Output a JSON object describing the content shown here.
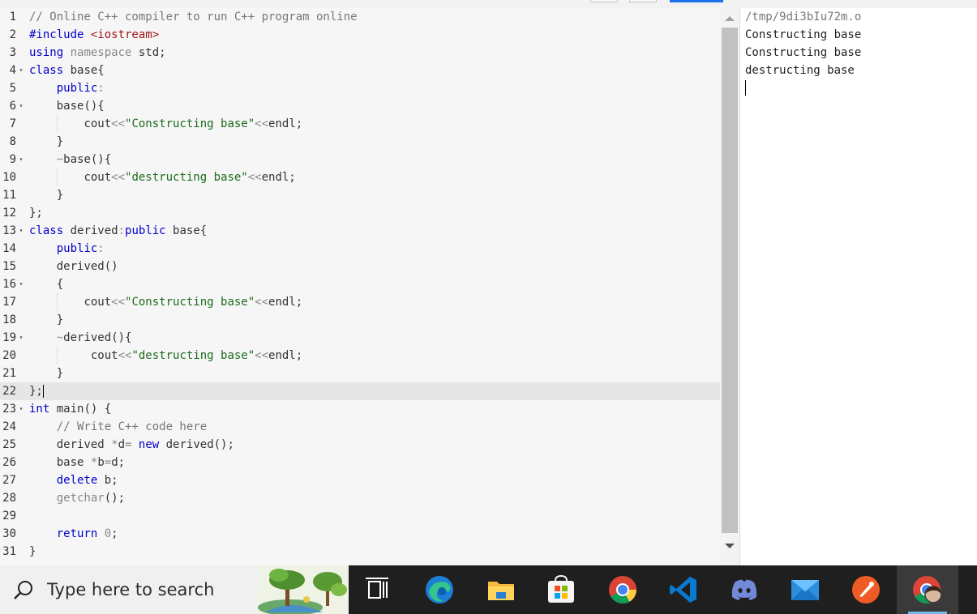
{
  "editor": {
    "lines": [
      {
        "n": "1",
        "fold": "",
        "indent": "",
        "segs": [
          [
            "c",
            "// Online C++ compiler to run C++ program online"
          ]
        ]
      },
      {
        "n": "2",
        "fold": "",
        "indent": "",
        "segs": [
          [
            "k",
            "#include "
          ],
          [
            "p",
            "<iostream>"
          ]
        ]
      },
      {
        "n": "3",
        "fold": "",
        "indent": "",
        "segs": [
          [
            "k",
            "using"
          ],
          [
            "t",
            " "
          ],
          [
            "o",
            "namespace"
          ],
          [
            "t",
            " std;"
          ]
        ]
      },
      {
        "n": "4",
        "fold": "▾",
        "indent": "",
        "segs": [
          [
            "k",
            "class"
          ],
          [
            "t",
            " base{"
          ]
        ]
      },
      {
        "n": "5",
        "fold": "",
        "indent": "    ",
        "segs": [
          [
            "k",
            "public"
          ],
          [
            "o",
            ":"
          ]
        ]
      },
      {
        "n": "6",
        "fold": "▾",
        "indent": "    ",
        "segs": [
          [
            "t",
            "base(){"
          ]
        ]
      },
      {
        "n": "7",
        "fold": "",
        "indent": "        ",
        "segs": [
          [
            "t",
            "cout"
          ],
          [
            "o",
            "<<"
          ],
          [
            "s",
            "\"Constructing base\""
          ],
          [
            "o",
            "<<"
          ],
          [
            "t",
            "endl;"
          ]
        ]
      },
      {
        "n": "8",
        "fold": "",
        "indent": "    ",
        "segs": [
          [
            "t",
            "}"
          ]
        ]
      },
      {
        "n": "9",
        "fold": "▾",
        "indent": "    ",
        "segs": [
          [
            "o",
            "~"
          ],
          [
            "t",
            "base(){"
          ]
        ]
      },
      {
        "n": "10",
        "fold": "",
        "indent": "        ",
        "segs": [
          [
            "t",
            "cout"
          ],
          [
            "o",
            "<<"
          ],
          [
            "s",
            "\"destructing base\""
          ],
          [
            "o",
            "<<"
          ],
          [
            "t",
            "endl;"
          ]
        ]
      },
      {
        "n": "11",
        "fold": "",
        "indent": "    ",
        "segs": [
          [
            "t",
            "}"
          ]
        ]
      },
      {
        "n": "12",
        "fold": "",
        "indent": "",
        "segs": [
          [
            "t",
            "};"
          ]
        ]
      },
      {
        "n": "13",
        "fold": "▾",
        "indent": "",
        "segs": [
          [
            "k",
            "class"
          ],
          [
            "t",
            " derived"
          ],
          [
            "o",
            ":"
          ],
          [
            "k",
            "public"
          ],
          [
            "t",
            " base{"
          ]
        ]
      },
      {
        "n": "14",
        "fold": "",
        "indent": "    ",
        "segs": [
          [
            "k",
            "public"
          ],
          [
            "o",
            ":"
          ]
        ]
      },
      {
        "n": "15",
        "fold": "",
        "indent": "    ",
        "segs": [
          [
            "t",
            "derived()"
          ]
        ]
      },
      {
        "n": "16",
        "fold": "▾",
        "indent": "    ",
        "segs": [
          [
            "t",
            "{"
          ]
        ]
      },
      {
        "n": "17",
        "fold": "",
        "indent": "        ",
        "segs": [
          [
            "t",
            "cout"
          ],
          [
            "o",
            "<<"
          ],
          [
            "s",
            "\"Constructing base\""
          ],
          [
            "o",
            "<<"
          ],
          [
            "t",
            "endl;"
          ]
        ]
      },
      {
        "n": "18",
        "fold": "",
        "indent": "    ",
        "segs": [
          [
            "t",
            "}"
          ]
        ]
      },
      {
        "n": "19",
        "fold": "▾",
        "indent": "    ",
        "segs": [
          [
            "o",
            "~"
          ],
          [
            "t",
            "derived(){"
          ]
        ]
      },
      {
        "n": "20",
        "fold": "",
        "indent": "         ",
        "segs": [
          [
            "t",
            "cout"
          ],
          [
            "o",
            "<<"
          ],
          [
            "s",
            "\"destructing base\""
          ],
          [
            "o",
            "<<"
          ],
          [
            "t",
            "endl;"
          ]
        ]
      },
      {
        "n": "21",
        "fold": "",
        "indent": "    ",
        "segs": [
          [
            "t",
            "}"
          ]
        ]
      },
      {
        "n": "22",
        "fold": "",
        "indent": "",
        "segs": [
          [
            "t",
            "};"
          ]
        ],
        "active": true
      },
      {
        "n": "23",
        "fold": "▾",
        "indent": "",
        "segs": [
          [
            "k",
            "int"
          ],
          [
            "t",
            " main() {"
          ]
        ]
      },
      {
        "n": "24",
        "fold": "",
        "indent": "    ",
        "segs": [
          [
            "c",
            "// Write C++ code here"
          ]
        ]
      },
      {
        "n": "25",
        "fold": "",
        "indent": "    ",
        "segs": [
          [
            "t",
            "derived "
          ],
          [
            "o",
            "*"
          ],
          [
            "t",
            "d"
          ],
          [
            "o",
            "="
          ],
          [
            "t",
            " "
          ],
          [
            "k",
            "new"
          ],
          [
            "t",
            " derived();"
          ]
        ]
      },
      {
        "n": "26",
        "fold": "",
        "indent": "    ",
        "segs": [
          [
            "t",
            "base "
          ],
          [
            "o",
            "*"
          ],
          [
            "t",
            "b"
          ],
          [
            "o",
            "="
          ],
          [
            "t",
            "d;"
          ]
        ]
      },
      {
        "n": "27",
        "fold": "",
        "indent": "    ",
        "segs": [
          [
            "k",
            "delete"
          ],
          [
            "t",
            " b;"
          ]
        ]
      },
      {
        "n": "28",
        "fold": "",
        "indent": "    ",
        "segs": [
          [
            "o",
            "getchar"
          ],
          [
            "t",
            "();"
          ]
        ]
      },
      {
        "n": "29",
        "fold": "",
        "indent": "",
        "segs": []
      },
      {
        "n": "30",
        "fold": "",
        "indent": "    ",
        "segs": [
          [
            "k",
            "return"
          ],
          [
            "t",
            " "
          ],
          [
            "o",
            "0"
          ],
          [
            "t",
            ";"
          ]
        ]
      },
      {
        "n": "31",
        "fold": "",
        "indent": "",
        "segs": [
          [
            "t",
            "}"
          ]
        ]
      }
    ]
  },
  "output": {
    "path": "/tmp/9di3bIu72m.o",
    "lines": [
      "Constructing base",
      "Constructing base",
      "destructing base"
    ]
  },
  "taskbar": {
    "search_placeholder": "Type here to search",
    "apps": [
      "task-view-icon",
      "edge-icon",
      "file-explorer-icon",
      "microsoft-store-icon",
      "chrome-icon",
      "vscode-icon",
      "discord-icon",
      "mail-icon",
      "postman-icon",
      "chrome-profile-icon"
    ]
  },
  "colors": {
    "keyword": "#0000cc",
    "string": "#1a6b1a",
    "include": "#a31515",
    "comment": "#777777",
    "taskbar": "#1f1f1f"
  }
}
